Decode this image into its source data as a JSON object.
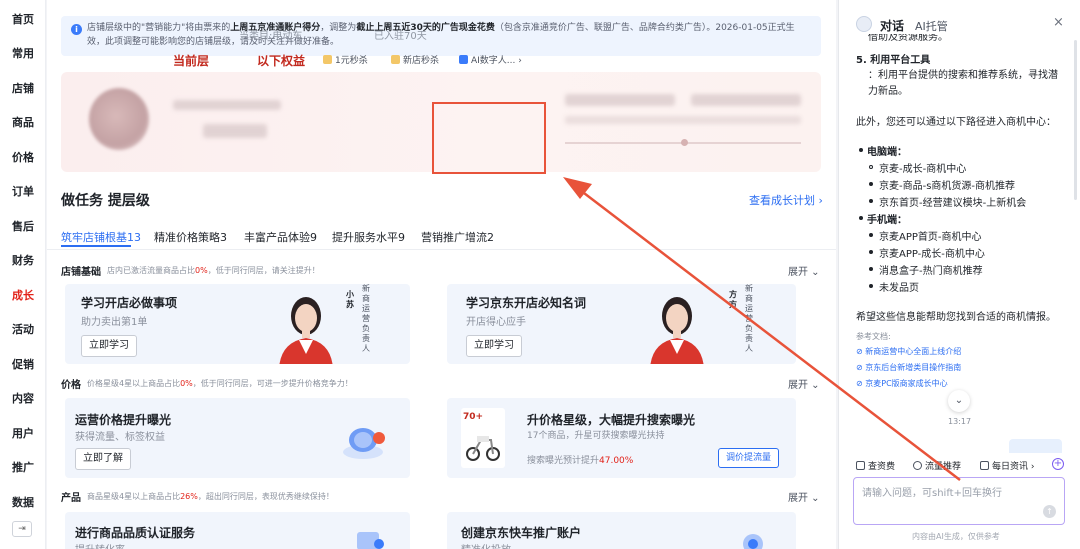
{
  "leftnav": {
    "items": [
      "首页",
      "常用",
      "店铺",
      "商品",
      "价格",
      "订单",
      "售后",
      "财务",
      "成长",
      "活动",
      "促销",
      "内容",
      "用户",
      "推广",
      "数据"
    ],
    "active_index": 8,
    "collapse_icon": "⇥"
  },
  "notice": {
    "icon": "i",
    "text_a": "店铺层级中的\"营销能力\"将由票来的",
    "bold_a": "上周五京准通账户得分",
    "text_b": "，调整为",
    "bold_b": "截止上周五近30天的广告现金花费",
    "text_c": "（包含京准通竞价广告、联盟广告、品牌合约类广告）。2026-01-05正式生效，此项调整可能影响您的店铺层级，请及时关注并做好准备。"
  },
  "banner": {
    "category": "当类目:电动车",
    "age": "已入驻70天",
    "rights_prefix": "当前层",
    "rights_suffix": "以下权益",
    "perks": [
      "1元秒杀",
      "新店秒杀",
      "AI数字人..."
    ]
  },
  "tasks": {
    "title": "做任务 提层级",
    "view_plan": "查看成长计划",
    "tabs": [
      "筑牢店铺根基13",
      "精准价格策略3",
      "丰富产品体验9",
      "提升服务水平9",
      "营销推广增流2"
    ],
    "active_tab": 0
  },
  "sections": {
    "basic": {
      "title": "店铺基础",
      "desc_a": "店内已激活流量商品占比",
      "desc_pct": "0%",
      "desc_b": "，低于同行同层，请关注提升！",
      "expand": "展开"
    },
    "price": {
      "title": "价格",
      "desc_a": "价格星级4星以上商品占比",
      "desc_pct": "0%",
      "desc_b": "，低于同行同层，可进一步提升价格竞争力！",
      "expand": "展开"
    },
    "product": {
      "title": "产品",
      "desc_a": "商品星级4星以上商品占比",
      "desc_pct": "26%",
      "desc_b": "，超出同行同层，表现优秀继续保持！",
      "expand": "展开"
    }
  },
  "cards": {
    "c1": {
      "title": "学习开店必做事项",
      "sub": "助力卖出第1单",
      "button": "立即学习",
      "name": "小苏",
      "role": "新商运营负责人"
    },
    "c2": {
      "title": "学习京东开店必知名词",
      "sub": "开店得心应手",
      "button": "立即学习",
      "name": "方方",
      "role": "新商运营负责人"
    },
    "c3": {
      "title": "运营价格提升曝光",
      "sub": "获得流量、标签权益",
      "button": "立即了解"
    },
    "c4": {
      "title": "升价格星级，大幅提升搜索曝光",
      "sub": "17个商品，升星可获搜索曝光扶持",
      "metric_label": "搜索曝光预计提升",
      "metric_value": "47.00%",
      "button": "调价提流量",
      "thumb_text": "70+"
    },
    "c5": {
      "title": "进行商品品质认证服务",
      "sub": "提升转化率"
    },
    "c6": {
      "title": "创建京东快车推广账户",
      "sub": "精准化投放"
    }
  },
  "rpanel": {
    "title": "对话",
    "tab": "AI托管",
    "close": "×",
    "top_cut": "借助及资源服务。",
    "point5_title": "5. 利用平台工具",
    "point5_text": "：利用平台提供的搜索和推荐系统，寻找潜力新品。",
    "intro": "此外，您还可以通过以下路径进入商机中心：",
    "pc_label": "电脑端",
    "pc_items": [
      "京麦-成长-商机中心",
      "京麦-商品-s商机货源-商机推荐",
      "京东首页-经营建议模块-上新机会"
    ],
    "mobile_label": "手机端",
    "mobile_items": [
      "京麦APP首页-商机中心",
      "京麦APP-成长-商机中心",
      "消息盒子-热门商机推荐",
      "未发品页"
    ],
    "closing": "希望这些信息能帮助您找到合适的商机情报。",
    "ref_label": "参考文档:",
    "refs": [
      "新商运营中心全面上线介绍",
      "京东后台新增类目操作指南",
      "京麦PC版商家成长中心"
    ],
    "time": "13:17",
    "tools": [
      "查资费",
      "流量推荐",
      "每日资讯"
    ],
    "input_placeholder": "请输入问题，可shift+回车换行",
    "disclaimer": "内容由AI生成，仅供参考"
  },
  "colors": {
    "accent": "#2c6ef2",
    "brand_red": "#e2231a",
    "annotation": "#e8533a"
  }
}
